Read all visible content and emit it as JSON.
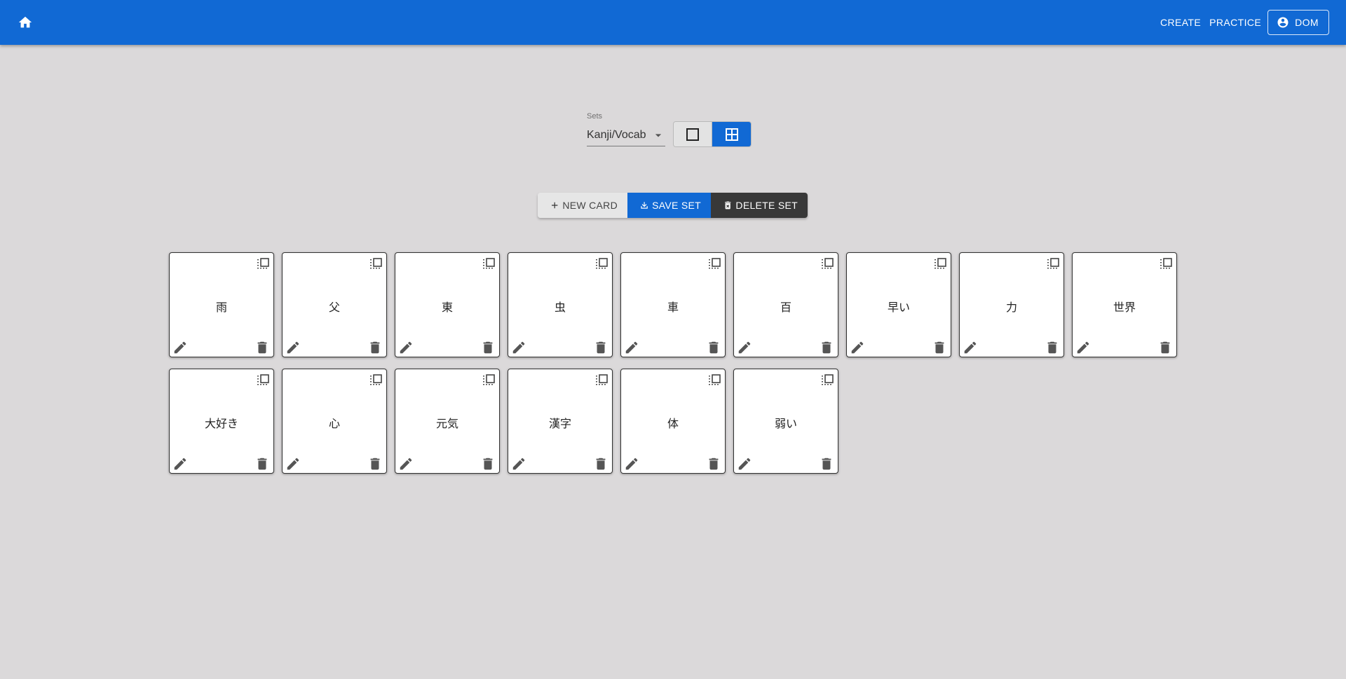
{
  "appbar": {
    "home_icon": "home-icon",
    "nav": {
      "create": "CREATE",
      "practice": "PRACTICE",
      "user": "DOM"
    },
    "user_icon": "account-circle-icon"
  },
  "sets": {
    "label": "Sets",
    "selected": "Kanji/Vocab",
    "view_toggle": {
      "single_icon": "square-outline-icon",
      "grid_icon": "grid-view-icon",
      "active": "grid"
    }
  },
  "actions": {
    "new_card": "NEW CARD",
    "save_set": "SAVE SET",
    "delete_set": "DELETE SET"
  },
  "cards": [
    {
      "text": "雨"
    },
    {
      "text": "父"
    },
    {
      "text": "東"
    },
    {
      "text": "虫"
    },
    {
      "text": "車"
    },
    {
      "text": "百"
    },
    {
      "text": "早い"
    },
    {
      "text": "力"
    },
    {
      "text": "世界"
    },
    {
      "text": "大好き"
    },
    {
      "text": "心"
    },
    {
      "text": "元気"
    },
    {
      "text": "漢字"
    },
    {
      "text": "体"
    },
    {
      "text": "弱い"
    }
  ],
  "colors": {
    "primary": "#1169d4",
    "background": "#dbd9da",
    "dark_button": "#383838"
  }
}
